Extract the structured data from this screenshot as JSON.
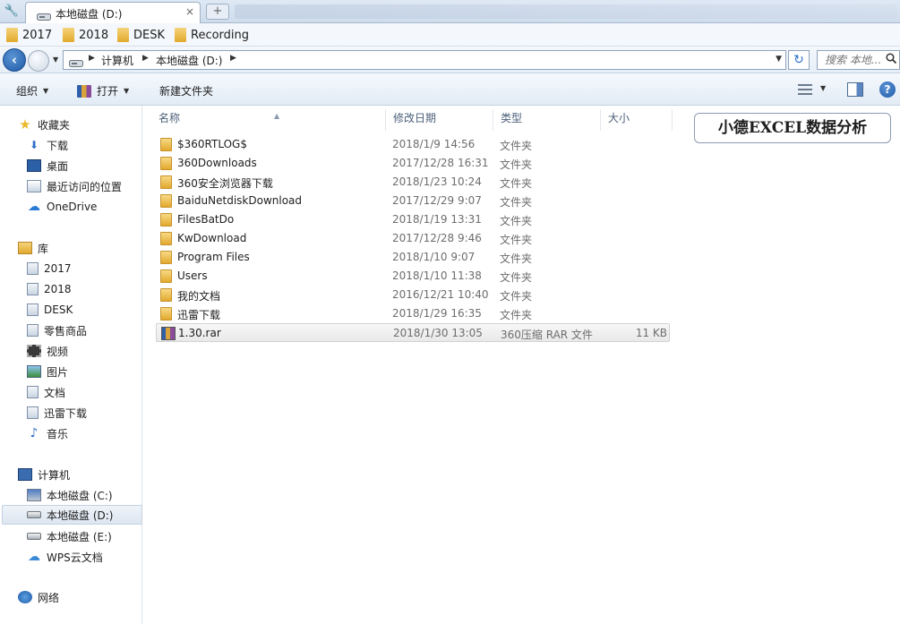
{
  "tabbar": {
    "active_tab": "本地磁盘 (D:)",
    "close_glyph": "×",
    "new_tab_glyph": "+"
  },
  "bookmarks": [
    "2017",
    "2018",
    "DESK",
    "Recording"
  ],
  "address": {
    "path": [
      "计算机",
      "本地磁盘 (D:)"
    ],
    "search_placeholder": "搜索 本地..."
  },
  "toolbar": {
    "organize": "组织",
    "open": "打开",
    "new_folder": "新建文件夹"
  },
  "sidebar": {
    "favorites": {
      "label": "收藏夹",
      "items": [
        "下载",
        "桌面",
        "最近访问的位置",
        "OneDrive"
      ]
    },
    "libraries": {
      "label": "库",
      "items": [
        "2017",
        "2018",
        "DESK",
        "零售商品",
        "视频",
        "图片",
        "文档",
        "迅雷下载",
        "音乐"
      ]
    },
    "computer": {
      "label": "计算机",
      "items": [
        "本地磁盘 (C:)",
        "本地磁盘 (D:)",
        "本地磁盘 (E:)",
        "WPS云文档"
      ],
      "selected": "本地磁盘 (D:)"
    },
    "network": {
      "label": "网络"
    }
  },
  "columns": {
    "name": "名称",
    "date": "修改日期",
    "type": "类型",
    "size": "大小"
  },
  "files": [
    {
      "name": "$360RTLOG$",
      "date": "2018/1/9 14:56",
      "type": "文件夹",
      "size": "",
      "kind": "folder"
    },
    {
      "name": "360Downloads",
      "date": "2017/12/28 16:31",
      "type": "文件夹",
      "size": "",
      "kind": "folder"
    },
    {
      "name": "360安全浏览器下载",
      "date": "2018/1/23 10:24",
      "type": "文件夹",
      "size": "",
      "kind": "folder"
    },
    {
      "name": "BaiduNetdiskDownload",
      "date": "2017/12/29 9:07",
      "type": "文件夹",
      "size": "",
      "kind": "folder"
    },
    {
      "name": "FilesBatDo",
      "date": "2018/1/19 13:31",
      "type": "文件夹",
      "size": "",
      "kind": "folder"
    },
    {
      "name": "KwDownload",
      "date": "2017/12/28 9:46",
      "type": "文件夹",
      "size": "",
      "kind": "folder"
    },
    {
      "name": "Program Files",
      "date": "2018/1/10 9:07",
      "type": "文件夹",
      "size": "",
      "kind": "folder"
    },
    {
      "name": "Users",
      "date": "2018/1/10 11:38",
      "type": "文件夹",
      "size": "",
      "kind": "folder"
    },
    {
      "name": "我的文档",
      "date": "2016/12/21 10:40",
      "type": "文件夹",
      "size": "",
      "kind": "folder"
    },
    {
      "name": "迅雷下载",
      "date": "2018/1/29 16:35",
      "type": "文件夹",
      "size": "",
      "kind": "folder"
    },
    {
      "name": "1.30.rar",
      "date": "2018/1/30 13:05",
      "type": "360压缩 RAR 文件",
      "size": "11 KB",
      "kind": "rar",
      "selected": true
    }
  ],
  "watermark": "小德EXCEL数据分析",
  "colors": {
    "accent_blue": "#1f5aa8",
    "folder_yellow": "#e3a92e",
    "text_gray": "#6d6d6d"
  },
  "icons": {
    "back": "back-arrow-icon",
    "forward": "forward-arrow-icon",
    "refresh": "refresh-icon",
    "search": "magnifier-icon",
    "help": "help-icon",
    "folder": "folder-icon",
    "rar": "rar-archive-icon"
  }
}
